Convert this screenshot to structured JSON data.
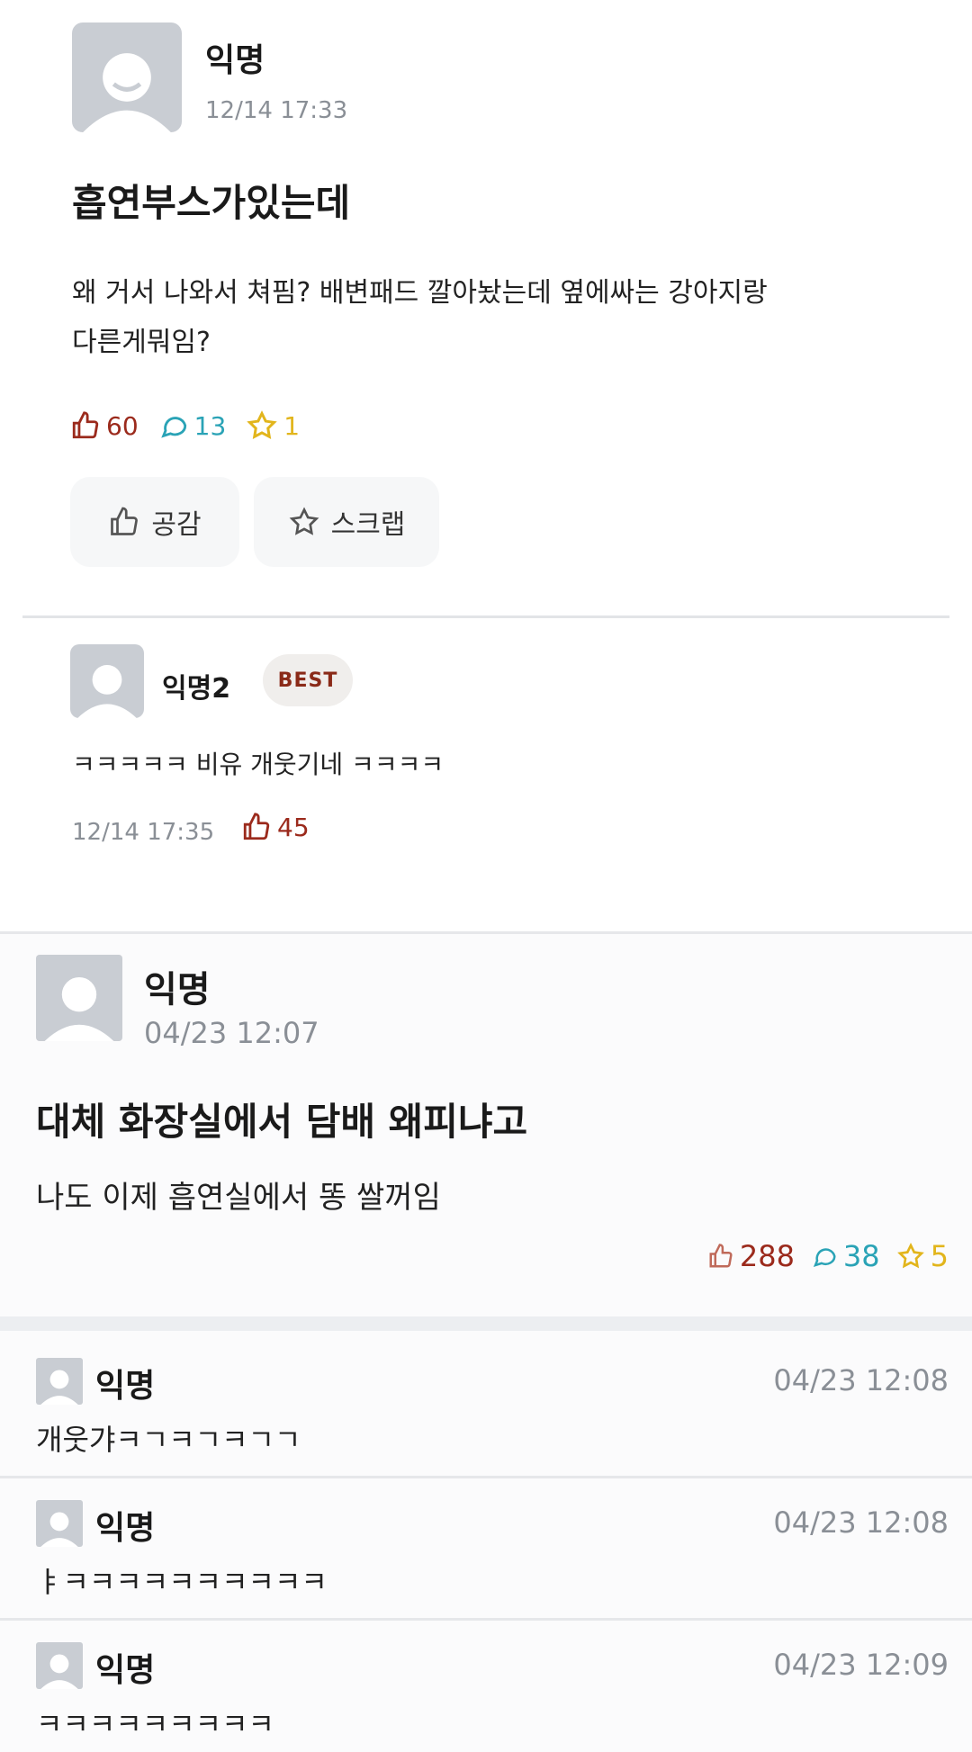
{
  "post1": {
    "author": "익명",
    "datetime": "12/14 17:33",
    "title": "흡연부스가있는데",
    "body_line1": "왜 거서 나와서 쳐핌? 배변패드 깔아놨는데 옆에싸는 강아지랑",
    "body_line2": "다른게뭐임?",
    "likes": "60",
    "comments": "13",
    "scraps": "1",
    "like_button": "공감",
    "scrap_button": "스크랩"
  },
  "comment1": {
    "author": "익명2",
    "badge": "BEST",
    "text": "ㅋㅋㅋㅋㅋ 비유 개웃기네 ㅋㅋㅋㅋ",
    "datetime": "12/14 17:35",
    "likes": "45"
  },
  "post2": {
    "author": "익명",
    "datetime": "04/23 12:07",
    "title": "대체 화장실에서 담배 왜피냐고",
    "body": "나도 이제 흡연실에서 똥 쌀꺼임",
    "likes": "288",
    "comments": "38",
    "scraps": "5"
  },
  "replies": [
    {
      "author": "익명",
      "datetime": "04/23 12:08",
      "text": "개웃갸ㅋㄱㅋㄱㅋㄱㄱ"
    },
    {
      "author": "익명",
      "datetime": "04/23 12:08",
      "text": "ㅑㅋㅋㅋㅋㅋㅋㅋㅋㅋㅋ"
    },
    {
      "author": "익명",
      "datetime": "04/23 12:09",
      "text": "ㅋㅋㅋㅋㅋㅋㅋㅋㅋ"
    }
  ],
  "colors": {
    "like": "#9b2a1c",
    "comment": "#2aa3b6",
    "scrap": "#e2b51c",
    "avatar_bg": "#c9cdd3",
    "meta": "#8a8f96"
  }
}
